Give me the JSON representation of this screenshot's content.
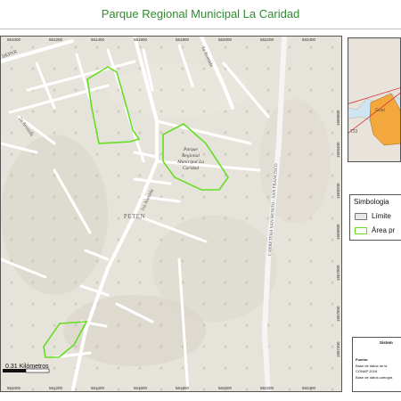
{
  "title": "Parque Regional Municipal La Caridad",
  "colors": {
    "title": "#2e8b2e",
    "terrain": "#e6e3da",
    "road": "#ffffff",
    "protected_area_outline": "#66dd22",
    "limit_fill": "#e8e8e8",
    "inset_water": "#cfe6f2",
    "inset_land": "#e8e4dc",
    "inset_region": "#f2a83c",
    "inset_line": "#d93030"
  },
  "map": {
    "top_ticks": [
      "561000",
      "561200",
      "561400",
      "561600",
      "561800",
      "562000",
      "562200",
      "562400"
    ],
    "bottom_ticks": [
      "561000",
      "561200",
      "561400",
      "561600",
      "561800",
      "562000",
      "562200",
      "562400"
    ],
    "right_ticks": [
      "1668600",
      "1668400",
      "1668200",
      "1668000",
      "1667800",
      "1667600",
      "1667400",
      "1667200",
      "1667000"
    ],
    "place_label": "PETEN",
    "park_label_lines": [
      "Parque",
      "Regional",
      "Municipal La",
      "Caridad"
    ],
    "road_labels": {
      "avenida_1a": "1a Avenida",
      "avenida_2a": "2a Avenida",
      "avenida_1ra": "1ra Avenida",
      "carretera": "CARRETERA SAN BENITO - SAN FRANCISCO",
      "depart": "DEPAR"
    },
    "scale_label": "0.31 Kilómetros"
  },
  "inset": {
    "labels": [
      "Guat",
      "723"
    ]
  },
  "legend": {
    "title": "Simbologia",
    "items": [
      {
        "label": "Límite",
        "type": "limit"
      },
      {
        "label": "Área pr",
        "type": "protected"
      }
    ]
  },
  "source": {
    "heading": "Sistem",
    "lines": [
      "Fuente:",
      "Base de datos de la",
      "CONAP 2016",
      "Base de datos cartogra"
    ]
  }
}
